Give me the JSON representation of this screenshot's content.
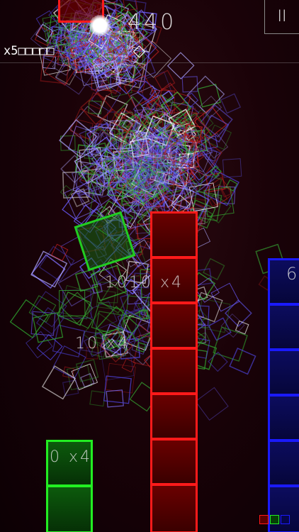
{
  "hud": {
    "score": "440",
    "multiplier": "x5□□□□□",
    "pause_label": "II"
  },
  "floating_scores": [
    {
      "text": "1010 x4"
    },
    {
      "text": "10 x4"
    },
    {
      "text": "0 x4"
    }
  ],
  "columns": {
    "red": {
      "cells": 7,
      "color": "#ff1a1a"
    },
    "green": {
      "cells": 2,
      "color": "#22ee22"
    },
    "blue": {
      "cells": 6,
      "color": "#1a1aff",
      "label": "6"
    }
  },
  "colors": {
    "red": "#ff1a1a",
    "green": "#22ee22",
    "blue": "#1a1aff",
    "background": "#1a0208"
  },
  "legend": [
    {
      "color": "#ff1a1a"
    },
    {
      "color": "#22ee22"
    },
    {
      "color": "#1a1aff"
    }
  ]
}
